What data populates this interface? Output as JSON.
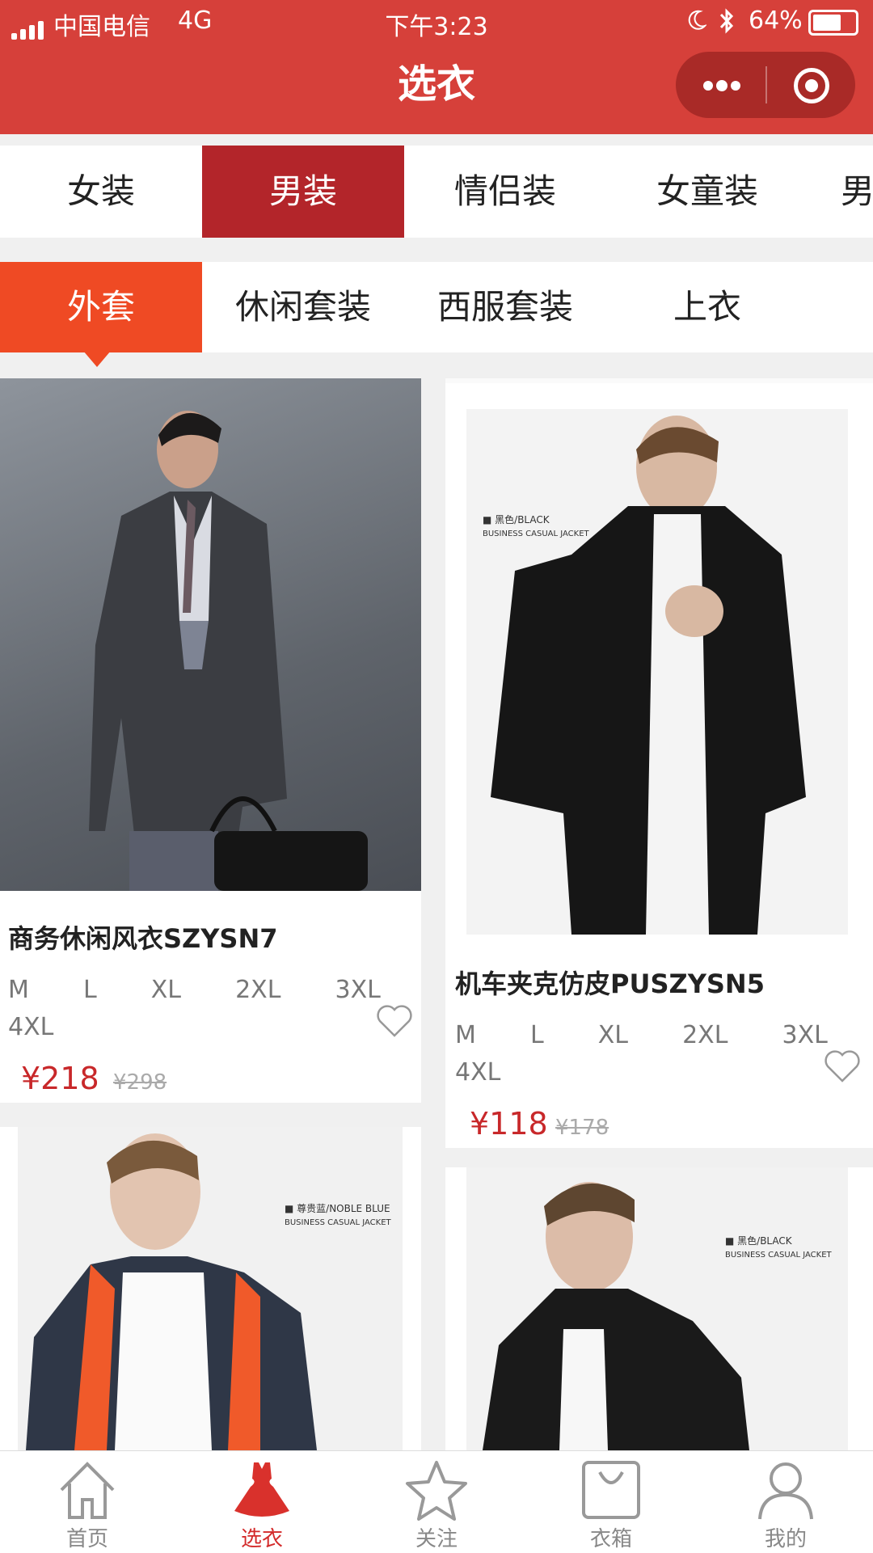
{
  "status_bar": {
    "carrier": "中国电信",
    "network": "4G",
    "time": "下午3:23",
    "battery": "64%"
  },
  "title": "选衣",
  "categories": [
    {
      "label": "女装",
      "active": false
    },
    {
      "label": "男装",
      "active": true
    },
    {
      "label": "情侣装",
      "active": false
    },
    {
      "label": "女童装",
      "active": false
    },
    {
      "label": "男",
      "active": false
    }
  ],
  "subcategories": [
    {
      "label": "外套",
      "active": true
    },
    {
      "label": "休闲套装",
      "active": false
    },
    {
      "label": "西服套装",
      "active": false
    },
    {
      "label": "上衣",
      "active": false
    }
  ],
  "products": [
    {
      "name": "商务休闲风衣SZYSN7",
      "sizes_line1": "M  L  XL  2XL  3XL",
      "sizes_line2": "4XL",
      "price": "¥218",
      "old_price": "¥298",
      "photo_tag": "",
      "photo_tag2": ""
    },
    {
      "name": "机车夹克仿皮PUSZYSN5",
      "sizes_line1": "M  L  XL  2XL  3XL",
      "sizes_line2": "4XL",
      "price": "¥118",
      "old_price": "¥178",
      "photo_tag": "■ 黑色/BLACK",
      "photo_tag2": "BUSINESS CASUAL JACKET"
    },
    {
      "name": "",
      "photo_tag": "■ 尊贵蓝/NOBLE BLUE",
      "photo_tag2": "BUSINESS CASUAL JACKET"
    },
    {
      "name": "",
      "photo_tag": "■ 黑色/BLACK",
      "photo_tag2": "BUSINESS CASUAL JACKET"
    }
  ],
  "bottom_nav": [
    {
      "label": "首页",
      "icon": "home-icon",
      "active": false
    },
    {
      "label": "选衣",
      "icon": "dress-icon",
      "active": true
    },
    {
      "label": "关注",
      "icon": "star-icon",
      "active": false
    },
    {
      "label": "衣箱",
      "icon": "bag-icon",
      "active": false
    },
    {
      "label": "我的",
      "icon": "person-icon",
      "active": false
    }
  ],
  "colors": {
    "header": "#d6403a",
    "category_active": "#b3252a",
    "sub_active": "#ef4a24",
    "price": "#c8282a"
  }
}
